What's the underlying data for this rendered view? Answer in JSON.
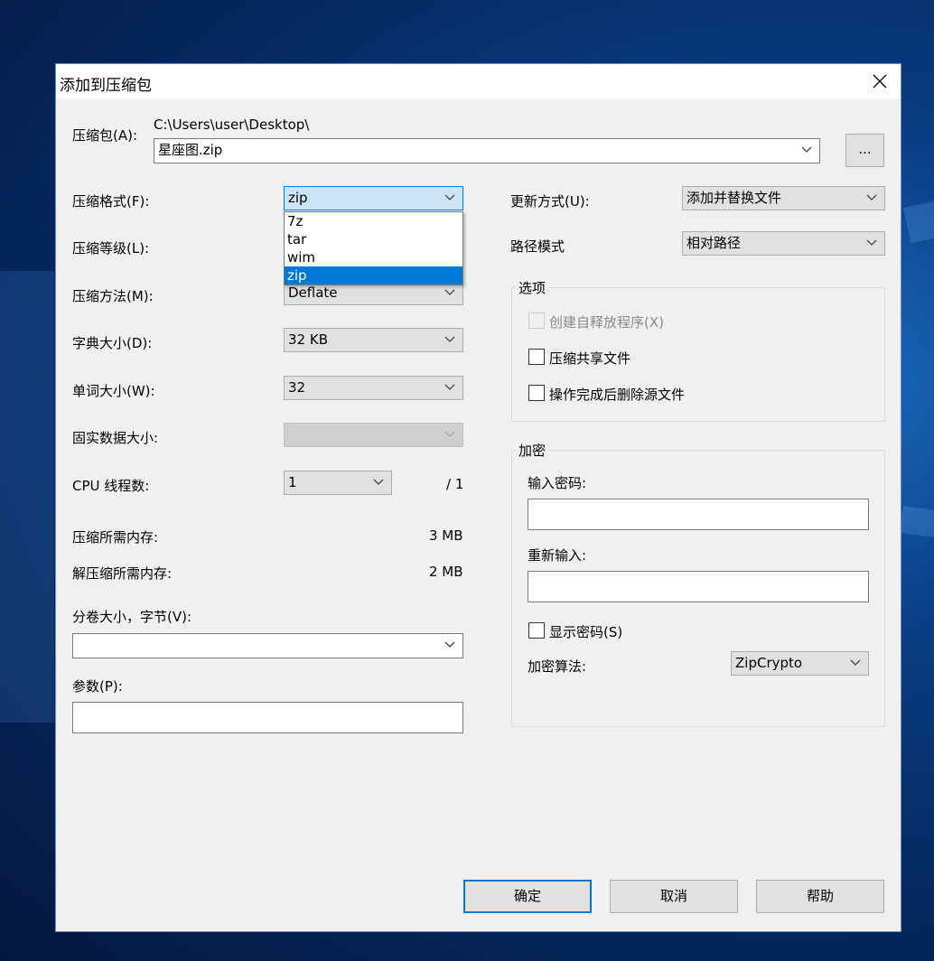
{
  "window": {
    "title": "添加到压缩包"
  },
  "archive": {
    "label": "压缩包(A):",
    "path": "C:\\Users\\user\\Desktop\\",
    "name": "星座图.zip",
    "browse_label": "..."
  },
  "left": {
    "format_label": "压缩格式(F):",
    "format_value": "zip",
    "format_options": [
      "7z",
      "tar",
      "wim",
      "zip"
    ],
    "level_label": "压缩等级(L):",
    "method_label": "压缩方法(M):",
    "method_value": "Deflate",
    "dict_label": "字典大小(D):",
    "dict_value": "32 KB",
    "word_label": "单词大小(W):",
    "word_value": "32",
    "solid_label": "固实数据大小:",
    "cpu_label": "CPU 线程数:",
    "cpu_value": "1",
    "cpu_total": "/ 1",
    "mem_compress_label": "压缩所需内存:",
    "mem_compress_value": "3 MB",
    "mem_decompress_label": "解压缩所需内存:",
    "mem_decompress_value": "2 MB",
    "volume_label": "分卷大小，字节(V):",
    "params_label": "参数(P):"
  },
  "right": {
    "update_label": "更新方式(U):",
    "update_value": "添加并替换文件",
    "path_label": "路径模式",
    "path_value": "相对路径",
    "options_title": "选项",
    "opt_sfx": "创建自释放程序(X)",
    "opt_shared": "压缩共享文件",
    "opt_delete": "操作完成后删除源文件",
    "encrypt_title": "加密",
    "password_label": "输入密码:",
    "reenter_label": "重新输入:",
    "show_password": "显示密码(S)",
    "algo_label": "加密算法:",
    "algo_value": "ZipCrypto"
  },
  "buttons": {
    "ok": "确定",
    "cancel": "取消",
    "help": "帮助"
  }
}
